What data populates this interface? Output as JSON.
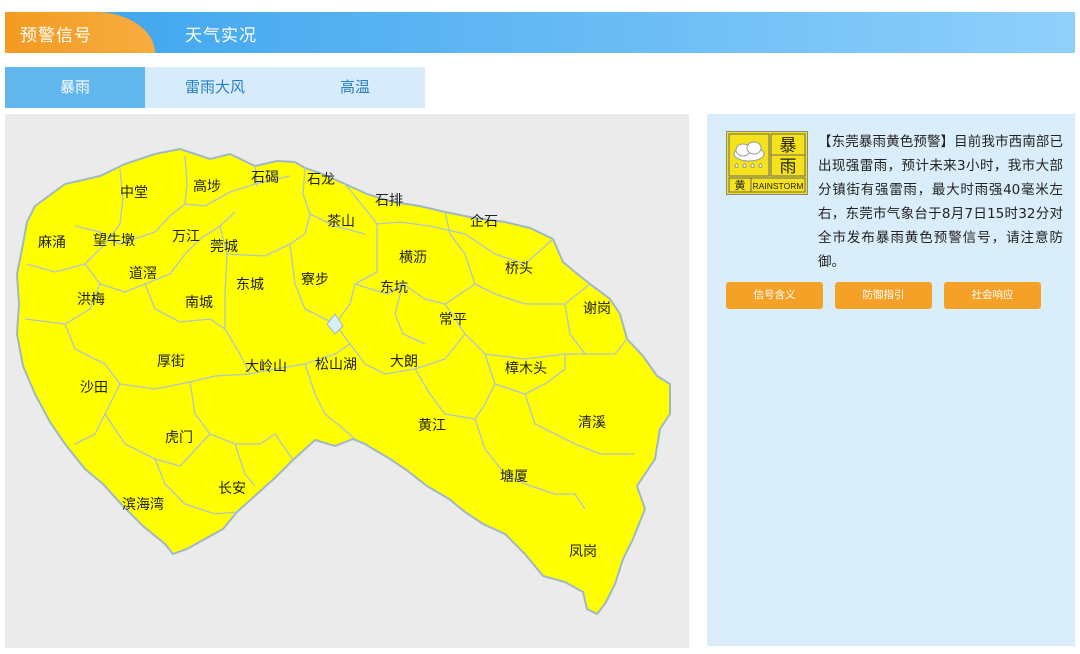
{
  "header": {
    "tab_warning": "预警信号",
    "tab_weather": "天气实况"
  },
  "subtabs": [
    "暴雨",
    "雷雨大风",
    "高温"
  ],
  "map": {
    "fill_color": "#ffff00",
    "border_color": "#9fb8c6",
    "towns": [
      "中堂",
      "高埗",
      "石碣",
      "石龙",
      "石排",
      "企石",
      "麻涌",
      "望牛墩",
      "万江",
      "莞城",
      "茶山",
      "横沥",
      "桥头",
      "道滘",
      "洪梅",
      "东城",
      "寮步",
      "东坑",
      "谢岗",
      "南城",
      "常平",
      "厚街",
      "大岭山",
      "松山湖",
      "大朗",
      "樟木头",
      "沙田",
      "虎门",
      "黄江",
      "清溪",
      "塘厦",
      "长安",
      "滨海湾",
      "凤岗"
    ]
  },
  "warning": {
    "icon": {
      "name": "rainstorm-yellow-warning-icon",
      "title_top": "暴",
      "title_bottom": "雨",
      "level": "黄",
      "english": "RAINSTORM",
      "color": "#f5e21a"
    },
    "text": "【东莞暴雨黄色预警】目前我市西南部已出现强雷雨，预计未来3小时，我市大部分镇街有强雷雨，最大时雨强40毫米左右，东莞市气象台于8月7日15时32分对全市发布暴雨黄色预警信号，请注意防御。"
  },
  "buttons": [
    "信号含义",
    "防御指引",
    "社会响应"
  ],
  "colors": {
    "accent_orange": "#f5a128",
    "header_blue": "#3aa3ee",
    "panel_bg": "#d9eefa"
  }
}
